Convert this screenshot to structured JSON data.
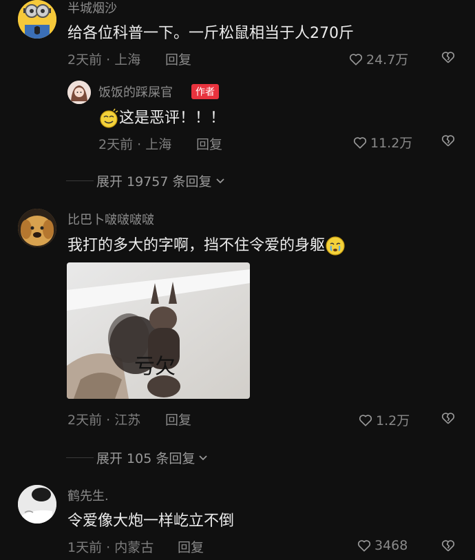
{
  "comments": [
    {
      "username": "半城烟沙",
      "text": "给各位科普一下。一斤松鼠相当于人270斤",
      "time_location": "2天前 · 上海",
      "reply_label": "回复",
      "likes": "24.7万"
    },
    {
      "username": "比巴卜啵啵啵啵",
      "text": "我打的多大的字啊，挡不住令爱的身躯",
      "time_location": "2天前 · 江苏",
      "reply_label": "回复",
      "likes": "1.2万",
      "image_caption": "亏欠"
    },
    {
      "username": "鹤先生.",
      "text": "令爱像大炮一样屹立不倒",
      "time_location": "1天前 · 内蒙古",
      "reply_label": "回复",
      "likes": "3468"
    }
  ],
  "author_reply": {
    "username": "饭饭的踩屎官",
    "badge": "作者",
    "text": "这是恶评！！！",
    "time_location": "2天前 · 上海",
    "reply_label": "回复",
    "likes": "11.2万"
  },
  "expand_links": [
    {
      "label": "展开 19757 条回复"
    },
    {
      "label": "展开 105 条回复"
    }
  ],
  "icons": {
    "like": "heart-outline-icon",
    "dislike": "broken-heart-icon",
    "expand": "chevron-down-icon"
  },
  "colors": {
    "background": "#101010",
    "author_badge": "#e8333e"
  }
}
